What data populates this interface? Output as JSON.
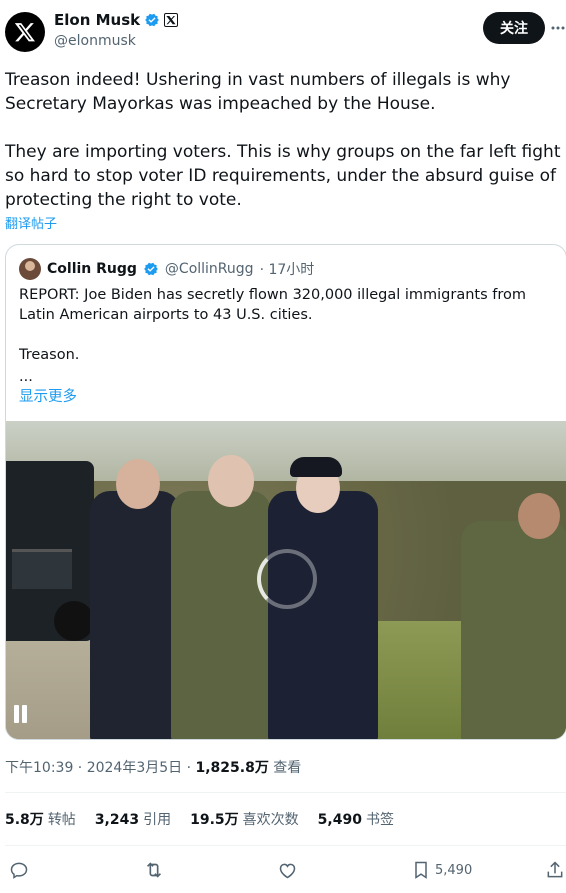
{
  "author": {
    "name": "Elon Musk",
    "handle": "@elonmusk",
    "follow_label": "关注"
  },
  "tweet": {
    "paragraph1": "Treason indeed! Ushering in vast numbers of illegals is why Secretary Mayorkas was impeached by the House.",
    "paragraph2": "They are importing voters. This is why groups on the far left fight so hard to stop voter ID requirements, under the absurd guise of protecting the right to vote.",
    "translate_label": "翻译帖子"
  },
  "quote": {
    "name": "Collin Rugg",
    "handle": "@CollinRugg",
    "time": "· 17小时",
    "text1": "REPORT: Joe Biden has secretly flown 320,000 illegal immigrants from Latin American airports to 43 U.S. cities.",
    "text2": "Treason.",
    "text3": "...",
    "show_more": "显示更多"
  },
  "meta": {
    "timestamp": "下午10:39 · 2024年3月5日 · ",
    "views": "1,825.8万",
    "views_label": " 查看"
  },
  "stats": [
    {
      "value": "5.8万",
      "label": "转帖"
    },
    {
      "value": "3,243",
      "label": "引用"
    },
    {
      "value": "19.5万",
      "label": "喜欢次数"
    },
    {
      "value": "5,490",
      "label": "书签"
    }
  ],
  "actions": {
    "bookmark_count": "5,490"
  },
  "colors": {
    "accent": "#1d9bf0",
    "verified": "#1d9bf0",
    "text": "#0f1419",
    "muted": "#536471"
  },
  "icons": [
    "x-logo-icon",
    "verified-icon",
    "x-badge-icon",
    "more-icon",
    "reply-icon",
    "retweet-icon",
    "like-icon",
    "bookmark-icon",
    "share-icon",
    "pause-icon",
    "loading-spinner-icon"
  ]
}
